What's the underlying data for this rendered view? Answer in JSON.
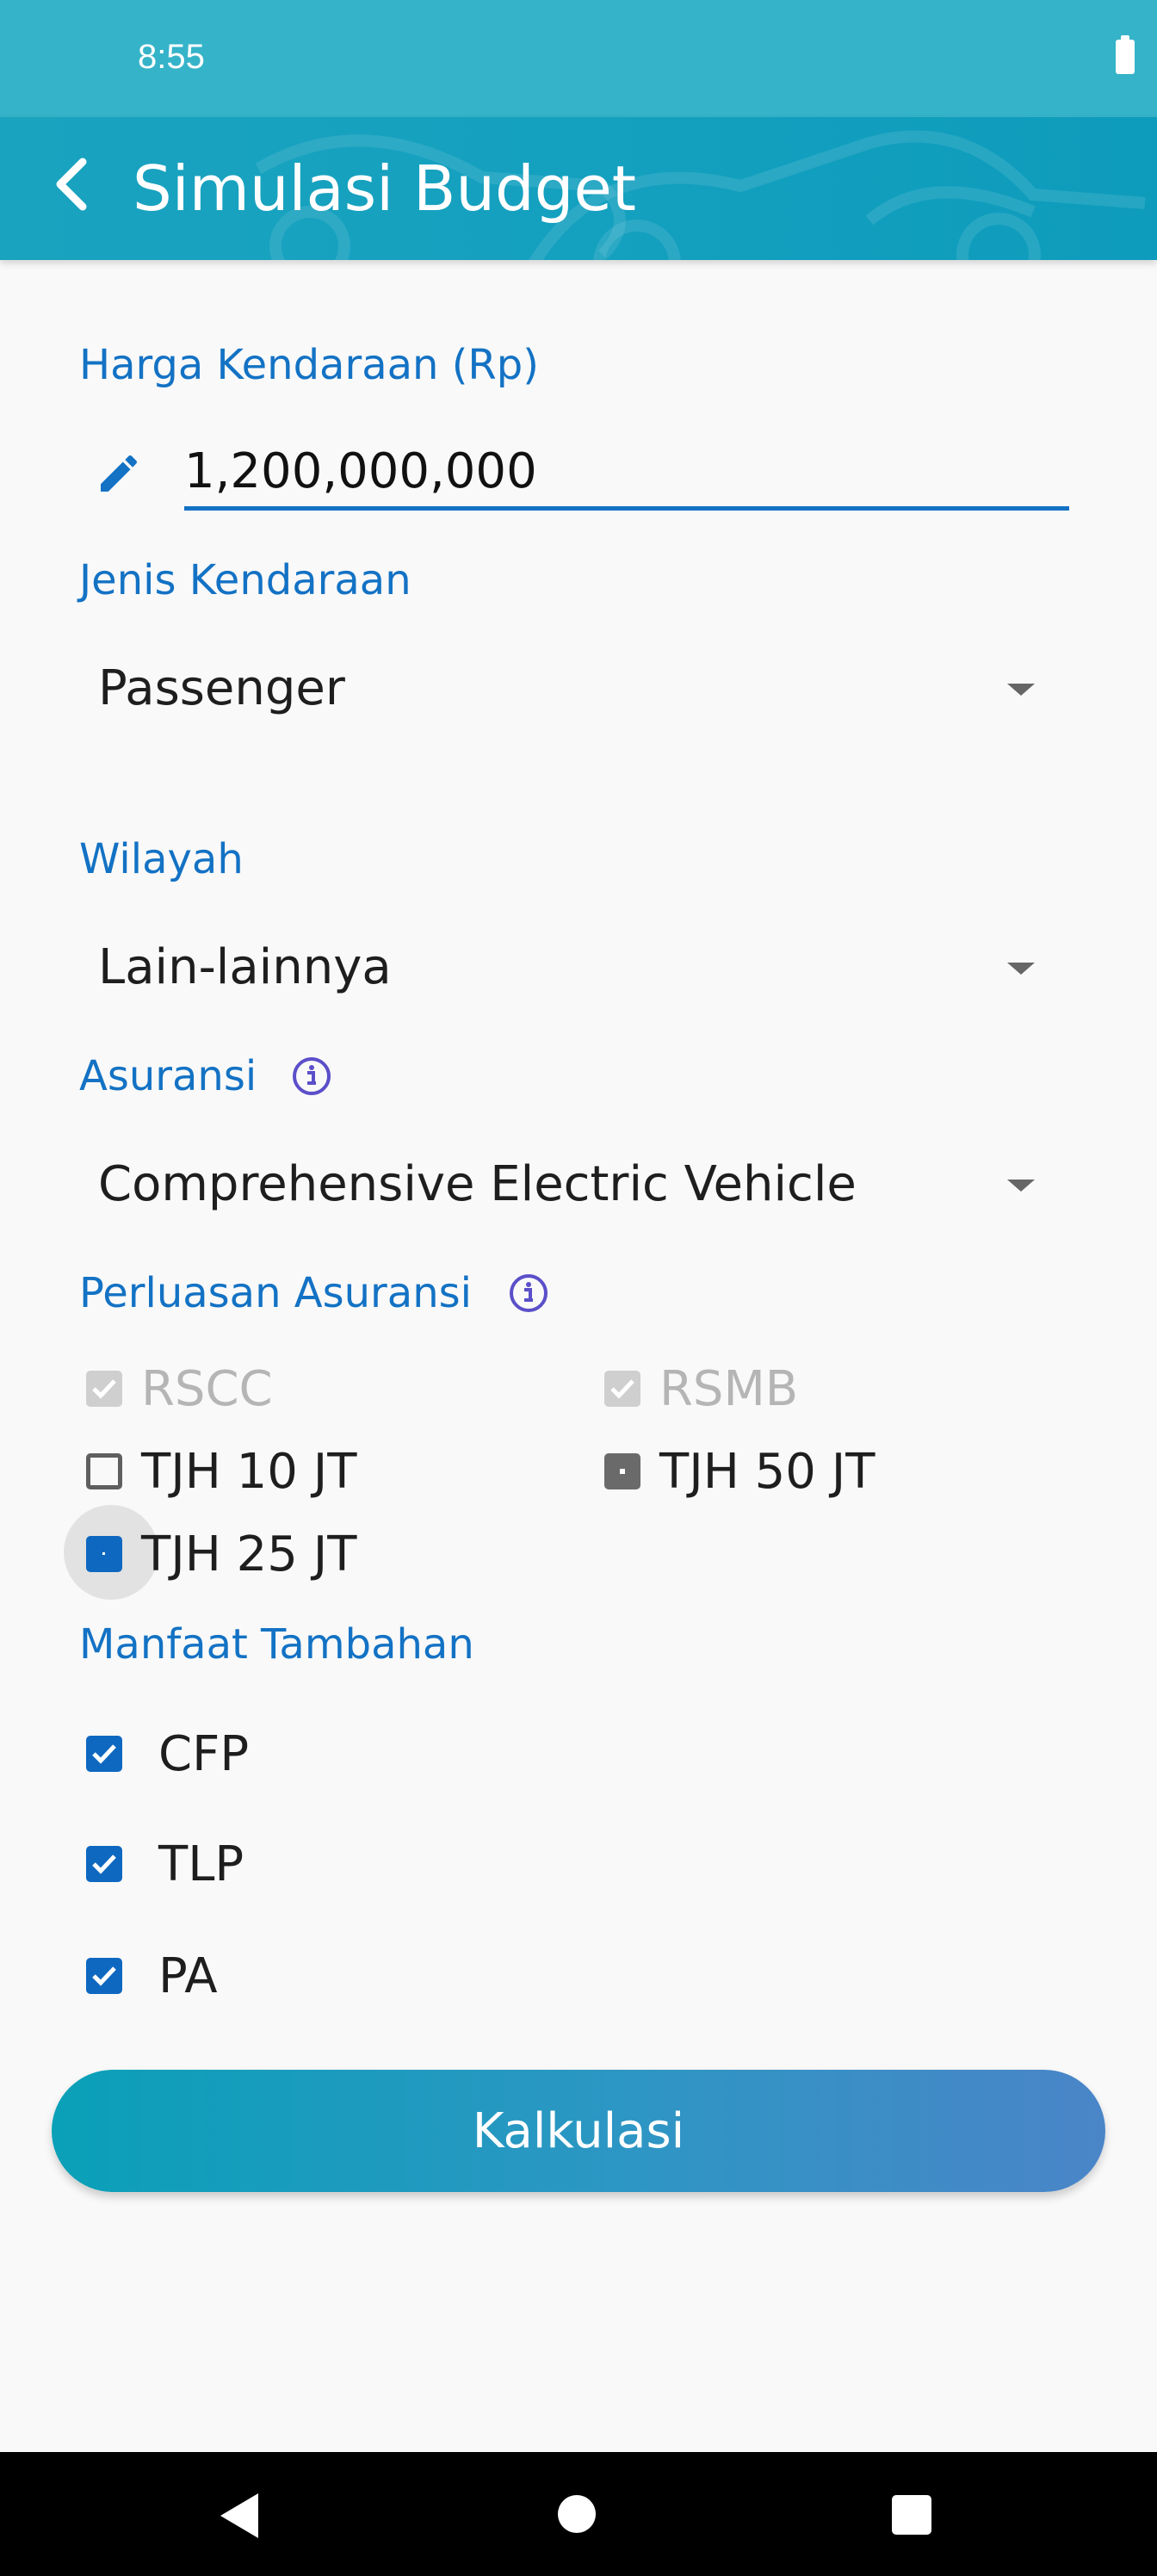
{
  "status_bar": {
    "time": "8:55"
  },
  "app_bar": {
    "title": "Simulasi Budget"
  },
  "form": {
    "price": {
      "label": "Harga Kendaraan (Rp)",
      "value": "1,200,000,000"
    },
    "vehicle_type": {
      "label": "Jenis Kendaraan",
      "selected": "Passenger"
    },
    "region": {
      "label": "Wilayah",
      "selected": "Lain-lainnya"
    },
    "insurance": {
      "label": "Asuransi",
      "selected": "Comprehensive Electric Vehicle"
    },
    "extension": {
      "label": "Perluasan Asuransi",
      "options": [
        {
          "label": "RSCC",
          "state": "checked-disabled"
        },
        {
          "label": "RSMB",
          "state": "checked-disabled"
        },
        {
          "label": "TJH 10 JT",
          "state": "unchecked"
        },
        {
          "label": "TJH 50 JT",
          "state": "partial"
        },
        {
          "label": "TJH 25 JT",
          "state": "partial-selected"
        }
      ]
    },
    "benefits": {
      "label": "Manfaat Tambahan",
      "options": [
        {
          "label": "CFP",
          "checked": true
        },
        {
          "label": "TLP",
          "checked": true
        },
        {
          "label": "PA",
          "checked": true
        }
      ]
    }
  },
  "actions": {
    "calculate_label": "Kalkulasi"
  },
  "icons": {
    "back": "arrow-back-icon",
    "edit": "pencil-icon",
    "info": "info-icon",
    "dropdown": "dropdown-arrow-icon",
    "battery": "battery-icon"
  },
  "colors": {
    "primary": "#1372c4",
    "status_bar": "#35b3c9",
    "app_bar": "#14a0bf",
    "button_start": "#0aa0b8",
    "button_end": "#4a85c8",
    "info_icon": "#5b4fc9"
  }
}
